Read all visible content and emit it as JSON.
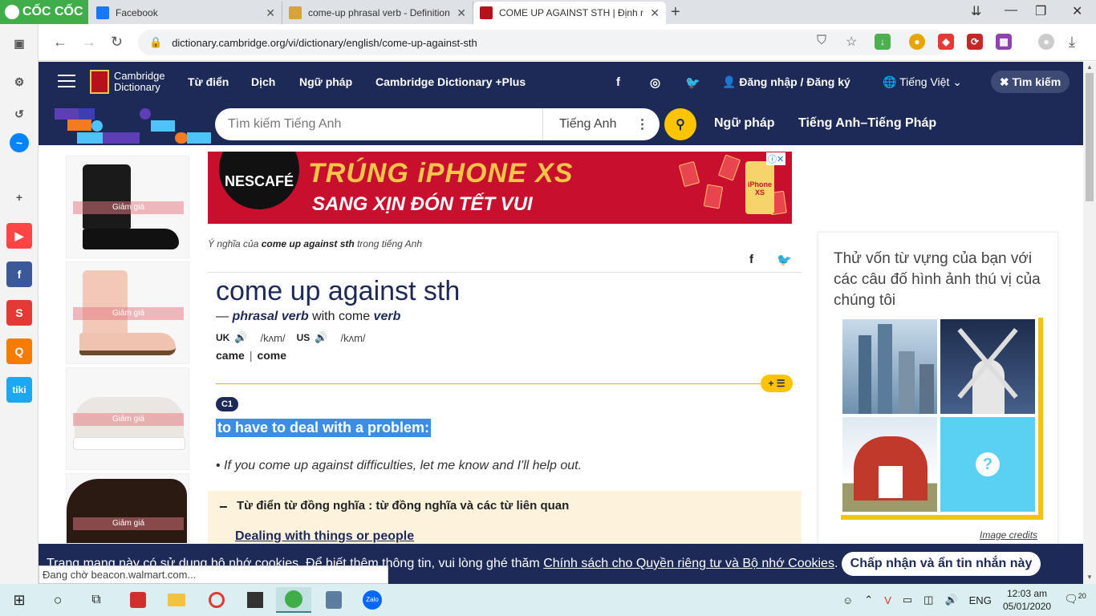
{
  "browser": {
    "brand": "CỐC CỐC",
    "tabs": [
      {
        "title": "Facebook",
        "icon": "facebook-icon"
      },
      {
        "title": "come-up phrasal verb - Definition,",
        "icon": "oxford-icon"
      },
      {
        "title": "COME UP AGAINST STH | Định ngh",
        "icon": "cambridge-icon"
      }
    ],
    "url": "dictionary.cambridge.org/vi/dictionary/english/come-up-against-sth",
    "status": "Đang chờ beacon.walmart.com..."
  },
  "header": {
    "logo_line1": "Cambridge",
    "logo_line2": "Dictionary",
    "nav": [
      "Từ điển",
      "Dịch",
      "Ngữ pháp",
      "Cambridge Dictionary +Plus"
    ],
    "login": "Đăng nhập / Đăng ký",
    "language": "Tiếng Việt",
    "search_button": "Tìm kiếm"
  },
  "search": {
    "placeholder": "Tìm kiếm Tiếng Anh",
    "dictionary": "Tiếng Anh",
    "links": [
      "Ngữ pháp",
      "Tiếng Anh–Tiếng Pháp"
    ]
  },
  "ads": {
    "sale_label": "Giảm giá",
    "banner_brand": "NESCAFÉ",
    "banner_headline": "TRÚNG iPHONE XS",
    "banner_sub": "SANG XỊN ĐÓN TẾT VUI",
    "banner_phone": "iPhone XS"
  },
  "entry": {
    "caption_prefix": "Ý nghĩa của ",
    "caption_term": "come up against sth",
    "caption_suffix": " trong tiếng Anh",
    "headword": "come up against sth",
    "dash": "—",
    "pos": "phrasal verb",
    "with_text": "with come",
    "verb_label": "verb",
    "uk": "UK",
    "us": "US",
    "ipa_uk": "/kʌm/",
    "ipa_us": "/kʌm/",
    "inflection1": "came",
    "separator": "|",
    "inflection2": "come",
    "level": "C1",
    "definition": "to have to deal with a problem:",
    "example": "If you come up against difficulties, let me know and I'll help out.",
    "thesaurus_title": "Từ điển từ đồng nghĩa : từ đồng nghĩa và các từ liên quan",
    "thesaurus_link": "Dealing with things or people"
  },
  "quiz": {
    "title": "Thử vốn từ vựng của bạn với các câu đố hình ảnh thú vị của chúng tôi",
    "credits": "Image credits",
    "unknown": "?"
  },
  "cookie": {
    "text_before": "Trang mạng này có sử dụng bộ nhớ cookies. Để biết thêm thông tin, vui lòng ghé thăm ",
    "link": "Chính sách cho Quyền riêng tư và Bộ nhớ Cookies",
    "text_after": ".",
    "accept": "Chấp nhận và ẩn tin nhắn này"
  },
  "taskbar": {
    "lang": "ENG",
    "time": "12:03 am",
    "date": "05/01/2020",
    "notifications": "20"
  },
  "colors": {
    "brand_navy": "#1d2a57",
    "accent_yellow": "#fec400",
    "highlight_blue": "#3b8ee5",
    "thesaurus_bg": "#fdf3dc",
    "coccoc_green": "#3fae49"
  }
}
